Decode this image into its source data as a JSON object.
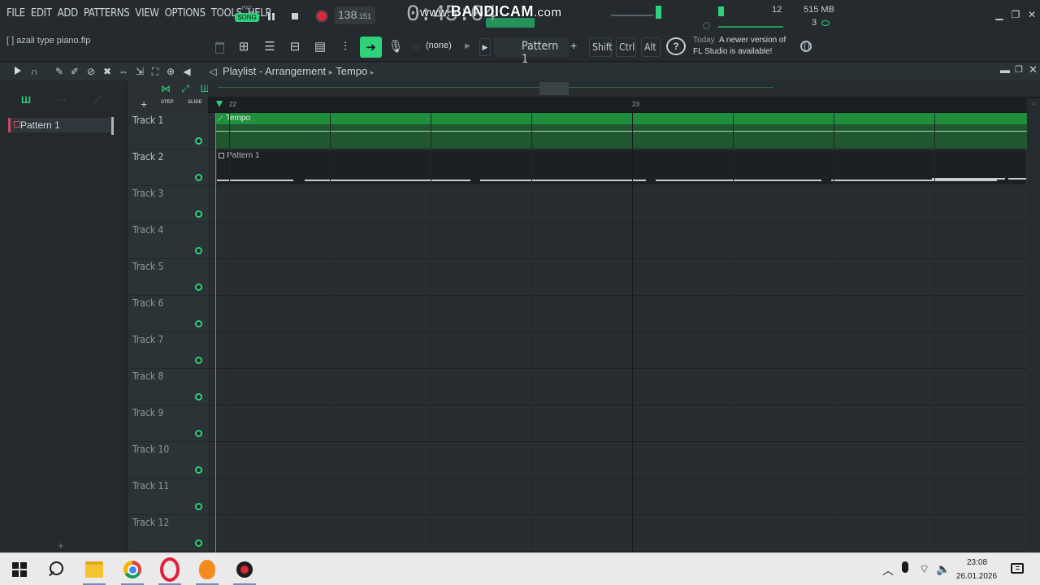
{
  "menu": [
    "FILE",
    "EDIT",
    "ADD",
    "PATTERNS",
    "VIEW",
    "OPTIONS",
    "TOOLS",
    "HELP"
  ],
  "project_file": "[  ] azali type piano.flp",
  "transport": {
    "pat_label": "PAT",
    "song_label": "SONG",
    "tempo_main": "138",
    "tempo_fraction": ".151",
    "time_display": "0:45:04"
  },
  "watermark": {
    "brand": "BANDICAM",
    "suffix": ".com",
    "prefix": "www."
  },
  "monitor": {
    "cpu": "12",
    "memory": "515 MB",
    "polyphony": "3"
  },
  "toolbar": {
    "midi_input": "(none)",
    "pattern": "Pattern 1",
    "pattern_add": "+",
    "keys": [
      "Shift",
      "Ctrl",
      "Alt"
    ]
  },
  "news": {
    "date": "Today",
    "line1": "A newer version of",
    "line2": "FL Studio is available!"
  },
  "playlist": {
    "title": "Playlist - Arrangement",
    "sep": "▸",
    "current": "Tempo",
    "step_label": "STEP",
    "slide_label": "SLIDE",
    "picker_item": "Pattern 1",
    "bars": [
      "22",
      "23"
    ],
    "tracks": [
      "Track 1",
      "Track 2",
      "Track 3",
      "Track 4",
      "Track 5",
      "Track 6",
      "Track 7",
      "Track 8",
      "Track 9",
      "Track 10",
      "Track 11",
      "Track 12"
    ],
    "clips": {
      "tempo": {
        "label": "Tempo",
        "track": 1,
        "color": "#1f8f3e"
      },
      "pattern": {
        "label": "Pattern 1",
        "track": 2
      }
    }
  },
  "taskbar": {
    "time": "23:08",
    "date": "26.01.2026",
    "apps": [
      "start-icon",
      "search-icon",
      "file-explorer-icon",
      "chrome-icon",
      "opera-icon",
      "fl-studio-icon",
      "bandicam-icon"
    ]
  },
  "colors": {
    "accent": "#2fd27a",
    "record": "#e0263b",
    "background": "#2a3034"
  }
}
